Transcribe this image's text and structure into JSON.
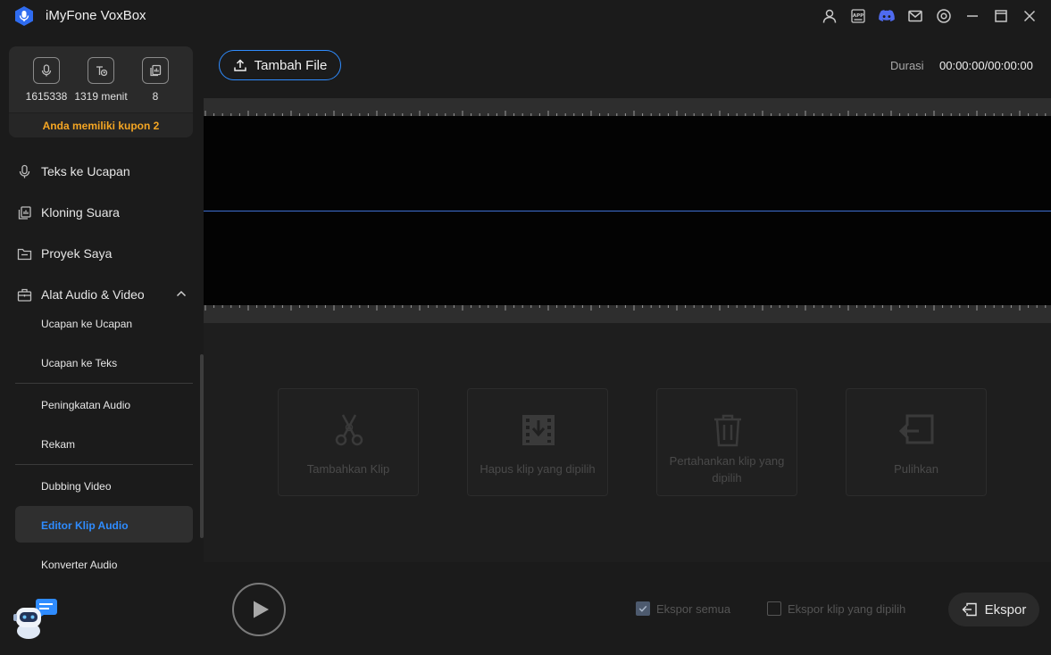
{
  "app": {
    "title": "iMyFone VoxBox"
  },
  "titlebar_icons": [
    "user-icon",
    "app-icon",
    "discord-icon",
    "mail-icon",
    "settings-icon",
    "minimize-icon",
    "maximize-icon",
    "close-icon"
  ],
  "titlebar_app_badge": "APP",
  "stats": [
    {
      "icon": "voice-icon",
      "value": "1615338"
    },
    {
      "icon": "text-clock-icon",
      "value": "1319 menit"
    },
    {
      "icon": "clone-icon",
      "value": "8"
    }
  ],
  "coupon": "Anda memiliki kupon 2",
  "nav": {
    "tts": "Teks ke Ucapan",
    "cloning": "Kloning Suara",
    "projects": "Proyek Saya",
    "audio_tools": "Alat Audio & Video"
  },
  "sub_items": {
    "s2s": "Ucapan ke Ucapan",
    "s2t": "Ucapan ke Teks",
    "enhance": "Peningkatan Audio",
    "record": "Rekam",
    "dubbing": "Dubbing Video",
    "clip_editor": "Editor Klip Audio",
    "converter": "Konverter Audio"
  },
  "main": {
    "add_file": "Tambah File",
    "duration_label": "Durasi",
    "duration_value": "00:00:00/00:00:00"
  },
  "tools": {
    "add_clip": "Tambahkan Klip",
    "delete_selected": "Hapus klip yang dipilih",
    "keep_selected": "Pertahankan klip yang dipilih",
    "restore": "Pulihkan"
  },
  "export": {
    "export_all": "Ekspor semua",
    "export_selected": "Ekspor klip yang dipilih",
    "export_button": "Ekspor"
  },
  "colors": {
    "accent": "#2f8cff",
    "coupon": "#f5a623",
    "wave_line": "#3e6fd1"
  }
}
